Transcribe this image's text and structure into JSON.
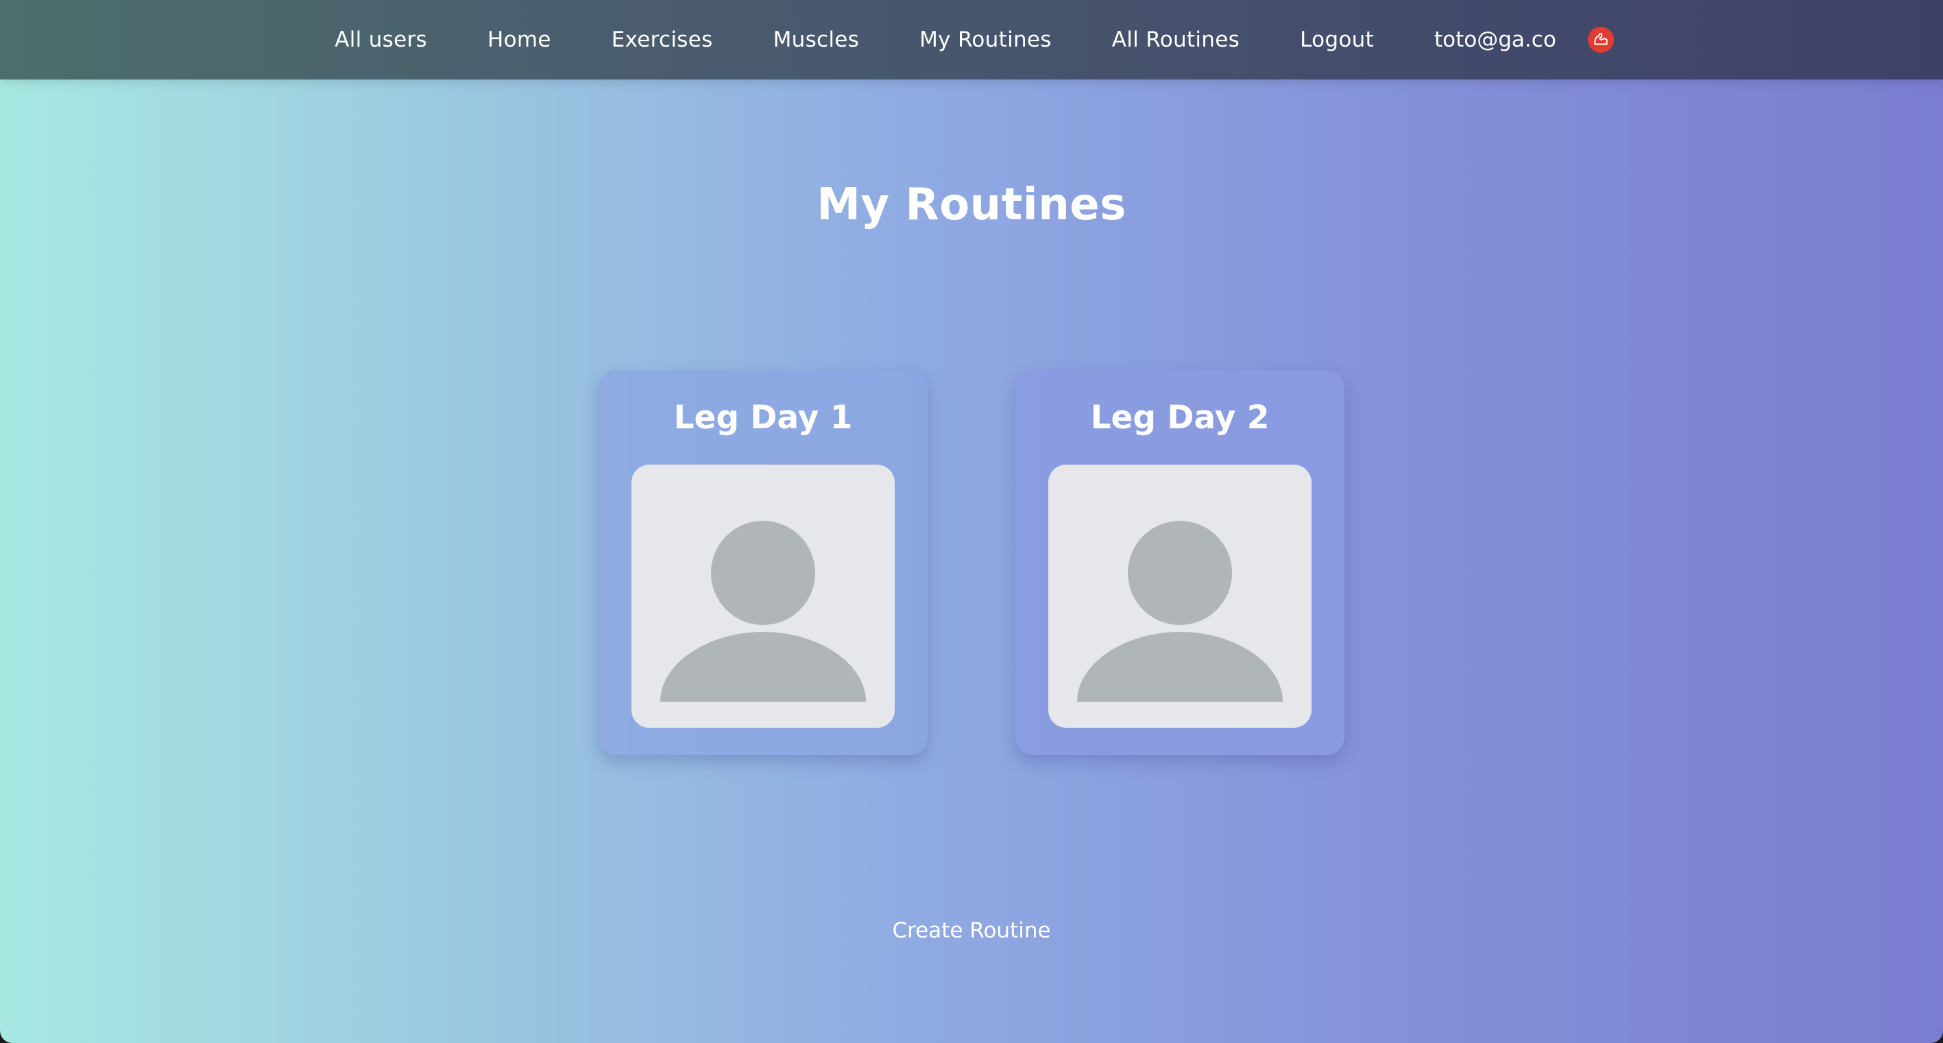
{
  "nav": {
    "links": [
      {
        "label": "All users"
      },
      {
        "label": "Home"
      },
      {
        "label": "Exercises"
      },
      {
        "label": "Muscles"
      },
      {
        "label": "My Routines"
      },
      {
        "label": "All Routines"
      },
      {
        "label": "Logout"
      }
    ],
    "user_email": "toto@ga.co",
    "logo_icon": "bicep-icon",
    "logo_color": "#e23b31"
  },
  "page": {
    "title": "My Routines"
  },
  "routines": [
    {
      "title": "Leg Day 1",
      "image_icon": "user-placeholder-icon"
    },
    {
      "title": "Leg Day 2",
      "image_icon": "user-placeholder-icon"
    }
  ],
  "actions": {
    "create_label": "Create Routine"
  },
  "colors": {
    "gradient_start": "#a7e8e2",
    "gradient_end": "#7a7dd0",
    "nav_start": "#4d6e6c",
    "nav_end": "#3f4068",
    "placeholder_bg": "#e5e7ea",
    "placeholder_fg": "#b0b5b7"
  }
}
